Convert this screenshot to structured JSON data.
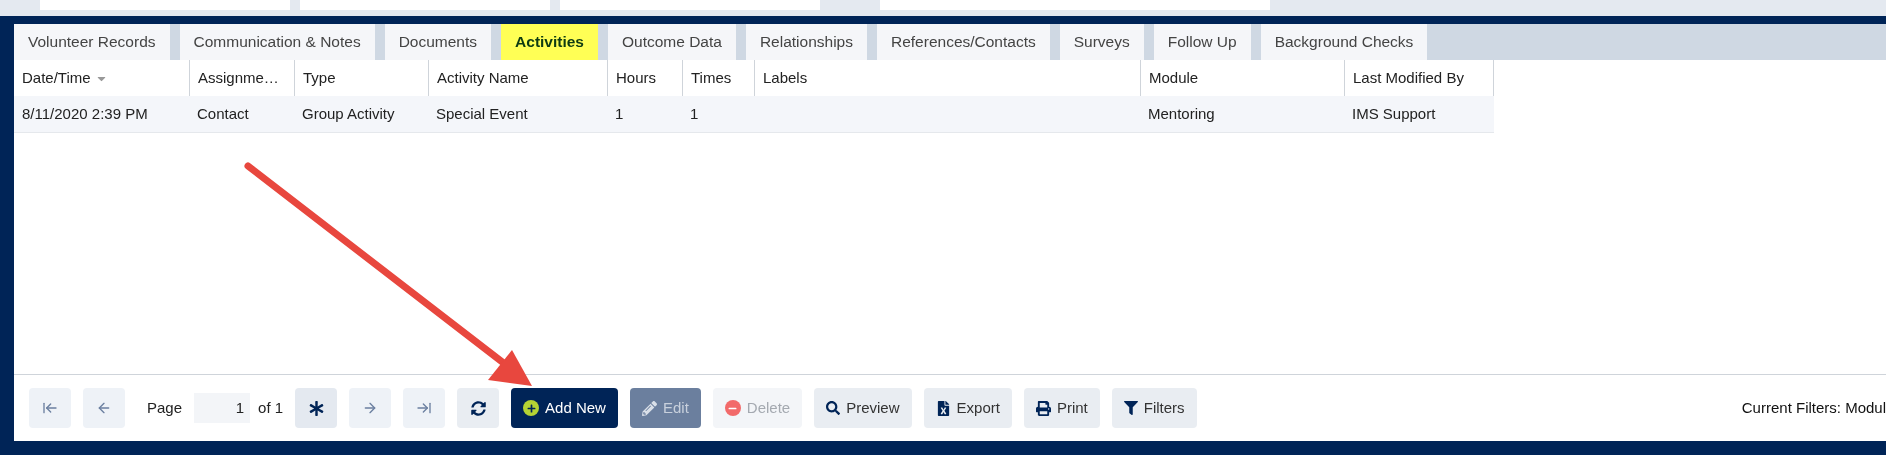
{
  "tabs": [
    {
      "label": "Volunteer Records",
      "selected": false
    },
    {
      "label": "Communication & Notes",
      "selected": false
    },
    {
      "label": "Documents",
      "selected": false
    },
    {
      "label": "Activities",
      "selected": true
    },
    {
      "label": "Outcome Data",
      "selected": false
    },
    {
      "label": "Relationships",
      "selected": false
    },
    {
      "label": "References/Contacts",
      "selected": false
    },
    {
      "label": "Surveys",
      "selected": false
    },
    {
      "label": "Follow Up",
      "selected": false
    },
    {
      "label": "Background Checks",
      "selected": false
    }
  ],
  "table": {
    "columns": [
      {
        "label": "Date/Time",
        "sorted": true
      },
      {
        "label": "Assignme…",
        "sorted": false
      },
      {
        "label": "Type",
        "sorted": false
      },
      {
        "label": "Activity Name",
        "sorted": false
      },
      {
        "label": "Hours",
        "sorted": false
      },
      {
        "label": "Times",
        "sorted": false
      },
      {
        "label": "Labels",
        "sorted": false
      },
      {
        "label": "Module",
        "sorted": false
      },
      {
        "label": "Last Modified By",
        "sorted": false
      }
    ],
    "rows": [
      {
        "cells": [
          "8/11/2020 2:39 PM",
          "Contact",
          "Group Activity",
          "Special Event",
          "1",
          "1",
          "",
          "Mentoring",
          "IMS Support"
        ]
      }
    ]
  },
  "pager": {
    "page_label": "Page",
    "page": "1",
    "of_label": "of 1"
  },
  "buttons": [
    {
      "kind": "refresh",
      "disabled": false
    },
    {
      "kind": "add",
      "label": "Add New",
      "disabled": false
    },
    {
      "kind": "edit",
      "label": "Edit",
      "disabled": true
    },
    {
      "kind": "delete",
      "label": "Delete",
      "disabled": true
    },
    {
      "kind": "preview",
      "label": "Preview",
      "disabled": false
    },
    {
      "kind": "export",
      "label": "Export",
      "disabled": false
    },
    {
      "kind": "print",
      "label": "Print",
      "disabled": false
    },
    {
      "kind": "filters",
      "label": "Filters",
      "disabled": false
    }
  ],
  "current_filters": "Current Filters: Modul"
}
